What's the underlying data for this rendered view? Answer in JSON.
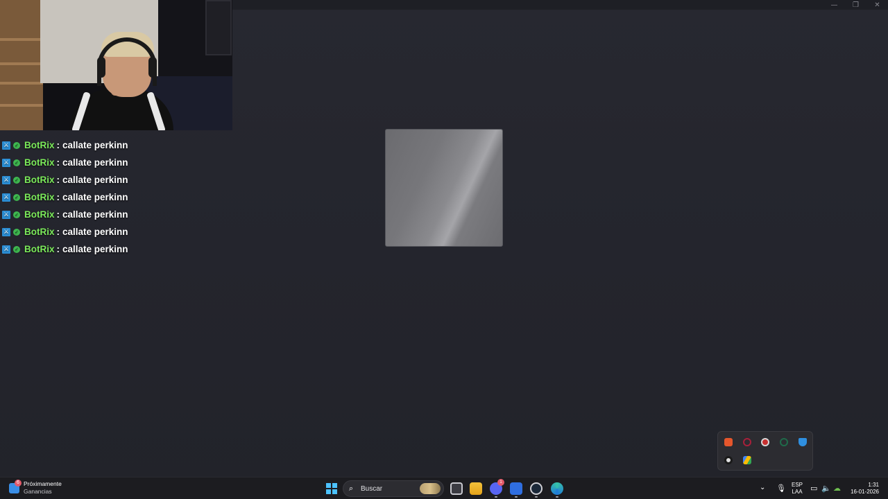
{
  "window": {
    "minimize_glyph": "—",
    "maximize_glyph": "❐",
    "close_glyph": "✕"
  },
  "chat": {
    "messages": [
      {
        "user": "BotRix",
        "separator": ":",
        "text": "callate perkinn"
      },
      {
        "user": "BotRix",
        "separator": ":",
        "text": "callate perkinn"
      },
      {
        "user": "BotRix",
        "separator": ":",
        "text": "callate perkinn"
      },
      {
        "user": "BotRix",
        "separator": ":",
        "text": "callate perkinn"
      },
      {
        "user": "BotRix",
        "separator": ":",
        "text": "callate perkinn"
      },
      {
        "user": "BotRix",
        "separator": ":",
        "text": "callate perkinn"
      },
      {
        "user": "BotRix",
        "separator": ":",
        "text": "callate perkinn"
      }
    ],
    "user_color": "#7bea5a",
    "badges": [
      "moderator-icon",
      "verified-icon"
    ]
  },
  "taskbar": {
    "widget": {
      "title": "Próximamente",
      "subtitle": "Ganancias",
      "badge": "6"
    },
    "search": {
      "icon": "search-icon",
      "label": "Buscar"
    },
    "apps": [
      "task-view-icon",
      "file-explorer-icon",
      "discord-icon",
      "roblox-icon",
      "steam-icon",
      "edge-icon"
    ],
    "discord_badge": "1"
  },
  "system_tray": {
    "chevron": "⌄",
    "mic": "🎙",
    "lang_line1": "ESP",
    "lang_line2": "LAA",
    "time": "1:31",
    "date": "16-01-2026",
    "popup_icons": [
      "obs-icon",
      "app-red-icon",
      "resolve-icon",
      "app-green-icon",
      "defender-icon",
      "steam-tray-icon",
      "drive-icon"
    ]
  },
  "colors": {
    "accent": "#4cc2ff",
    "background": "#25262d",
    "taskbar": "#1c1c20"
  }
}
